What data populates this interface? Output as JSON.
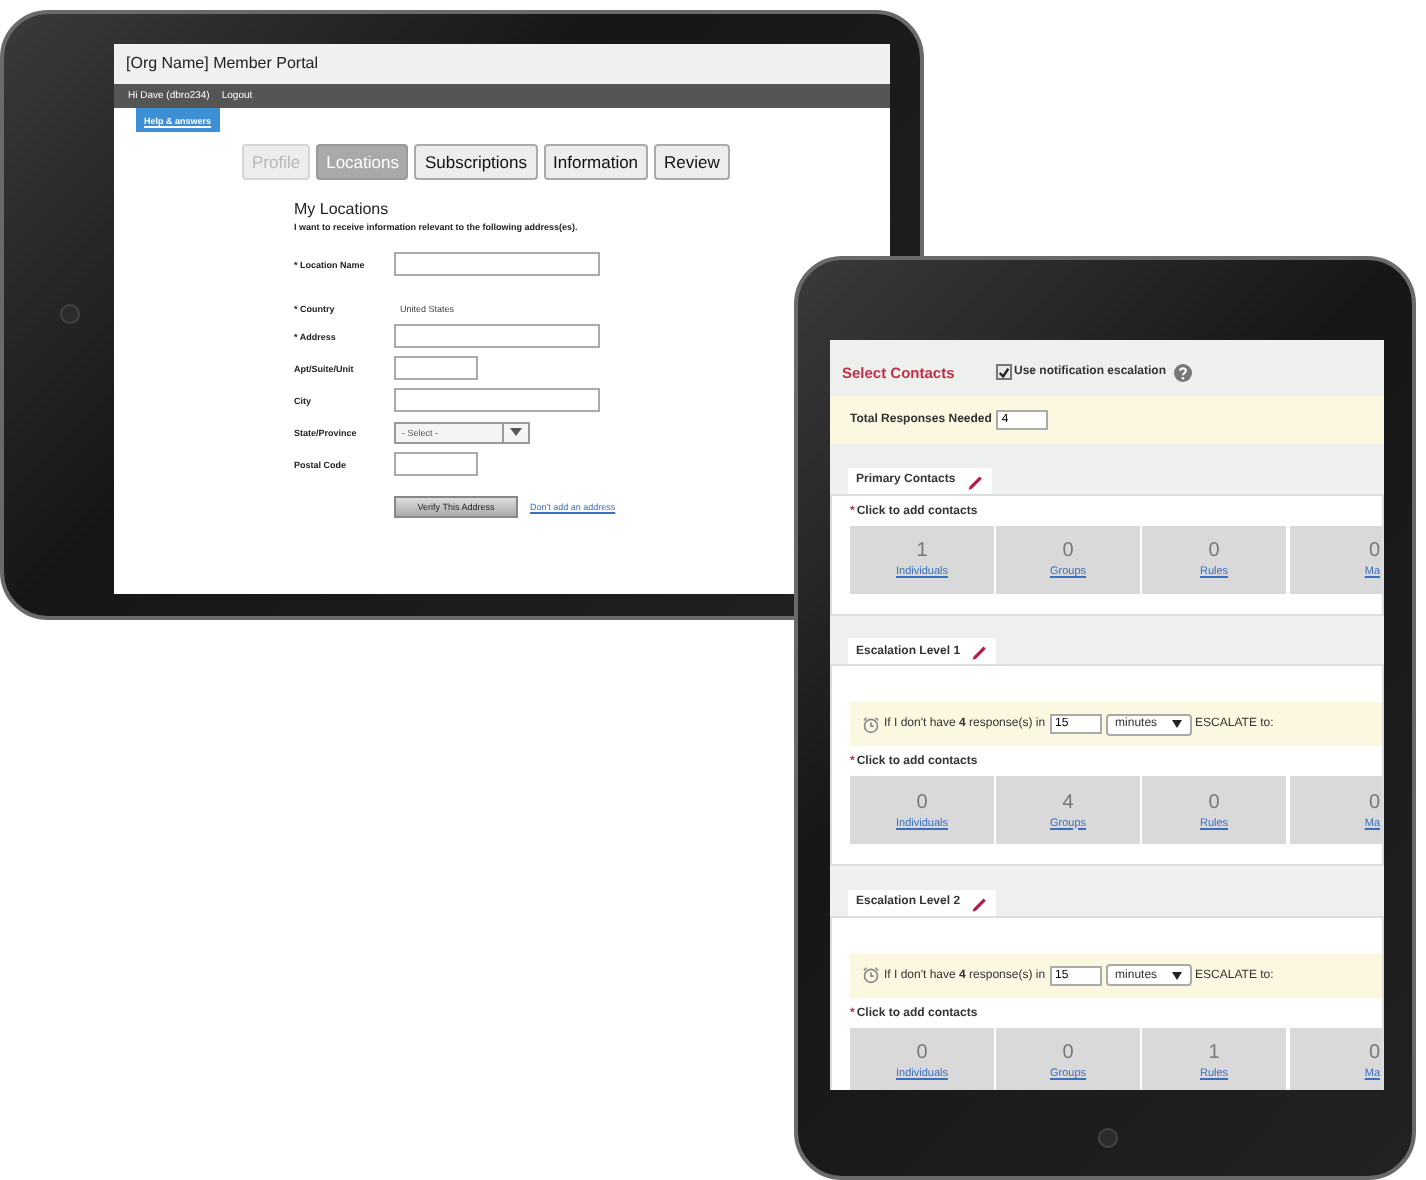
{
  "portal": {
    "title": "[Org Name] Member Portal",
    "user_bar": {
      "greeting": "Hi Dave (dbro234)",
      "logout": "Logout"
    },
    "help": "Help & answers",
    "tabs": [
      {
        "label": "Profile",
        "selected": false,
        "disabled": true
      },
      {
        "label": "Locations",
        "selected": true,
        "disabled": false
      },
      {
        "label": "Subscriptions",
        "selected": false,
        "disabled": false
      },
      {
        "label": "Information",
        "selected": false,
        "disabled": false
      },
      {
        "label": "Review",
        "selected": false,
        "disabled": false
      }
    ],
    "heading": "My Locations",
    "intro": "I want to receive information relevant to the following address(es).",
    "fields": [
      {
        "kind": "input",
        "label": "* Location Name"
      },
      {
        "kind": "text",
        "label": "* Country",
        "value": "United States"
      },
      {
        "kind": "input",
        "label": "* Address"
      },
      {
        "kind": "short-input",
        "label": "Apt/Suite/Unit"
      },
      {
        "kind": "input",
        "label": "City"
      },
      {
        "kind": "select",
        "label": "State/Province",
        "value": "- Select -"
      },
      {
        "kind": "short-input",
        "label": "Postal Code"
      }
    ],
    "verify_button": "Verify This Address",
    "skip_link": "Don't add an address"
  },
  "contacts": {
    "title": "Select Contacts",
    "escalation": {
      "label": "Use notification escalation",
      "checked": true
    },
    "total": {
      "label": "Total Responses Needed",
      "value": "4"
    },
    "sections": [
      {
        "title": "Primary Contacts",
        "marker": "*",
        "prompt": "Click to add contacts",
        "counts": [
          {
            "value": "1",
            "label": "Individuals"
          },
          {
            "value": "0",
            "label": "Groups"
          },
          {
            "value": "0",
            "label": "Rules"
          },
          {
            "value": "0",
            "label": "Ma"
          }
        ]
      },
      {
        "title": "Escalation Level 1",
        "rule": {
          "text": "If I don't have **4** response(s) in",
          "value": "15",
          "unit": "minutes",
          "suffix": "ESCALATE to:"
        },
        "marker": "*",
        "prompt": "Click to add contacts",
        "counts": [
          {
            "value": "0",
            "label": "Individuals"
          },
          {
            "value": "4",
            "label": "Groups"
          },
          {
            "value": "0",
            "label": "Rules"
          },
          {
            "value": "0",
            "label": "Ma"
          }
        ]
      },
      {
        "title": "Escalation Level 2",
        "rule": {
          "text": "If I don't have **4** response(s) in",
          "value": "15",
          "unit": "minutes",
          "suffix": "ESCALATE to:"
        },
        "marker": "*",
        "prompt": "Click to add contacts",
        "counts": [
          {
            "value": "0",
            "label": "Individuals"
          },
          {
            "value": "0",
            "label": "Groups"
          },
          {
            "value": "1",
            "label": "Rules"
          },
          {
            "value": "0",
            "label": "Ma"
          }
        ]
      }
    ]
  }
}
